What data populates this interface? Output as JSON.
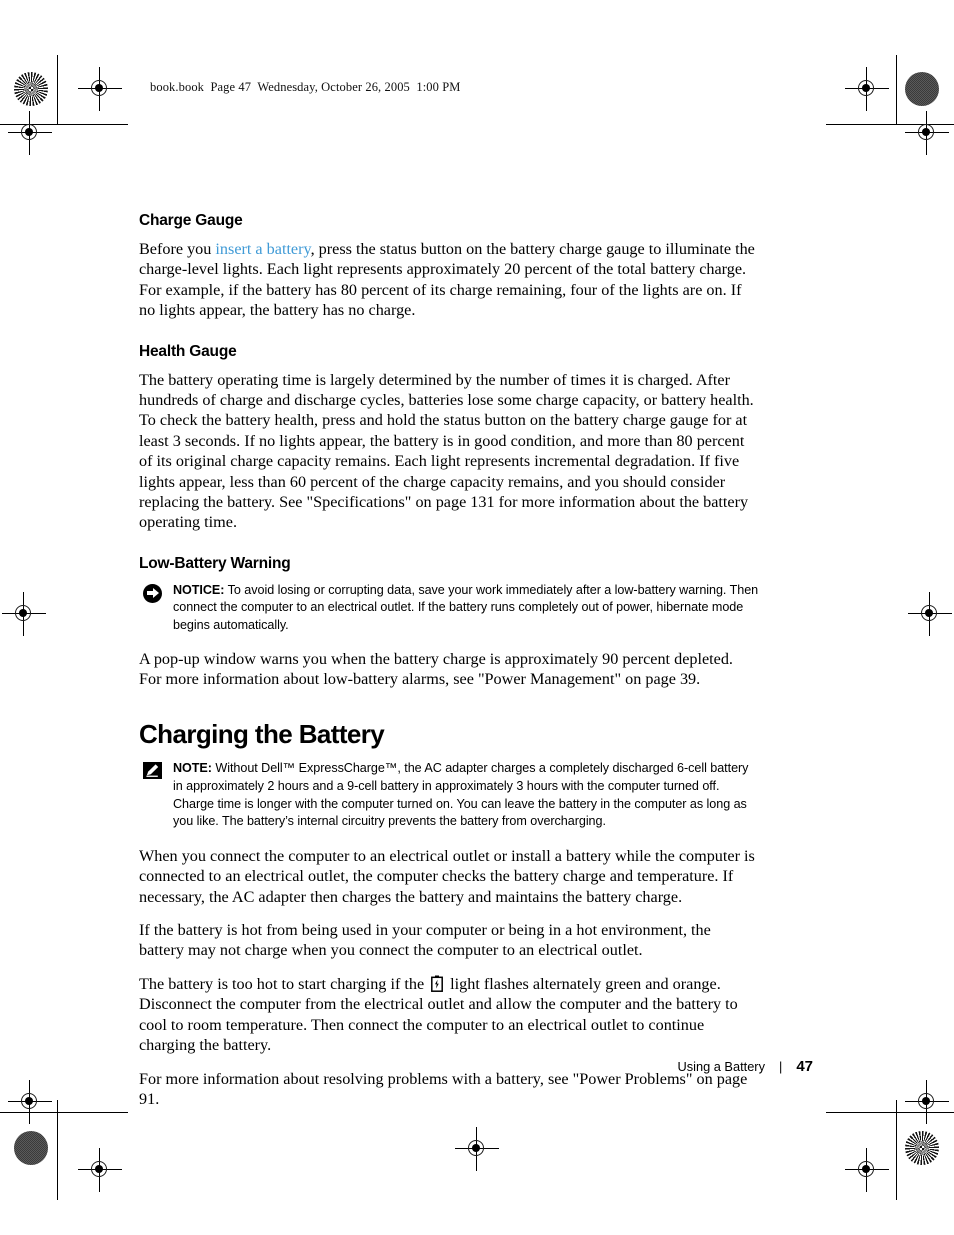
{
  "page": {
    "slug": "book.book  Page 47  Wednesday, October 26, 2005  1:00 PM",
    "link_color": "#3f9ad6"
  },
  "sections": {
    "charge_gauge": {
      "heading": "Charge Gauge",
      "para_before_link": "Before you ",
      "link_text": "insert a battery",
      "para_after_link": ", press the status button on the battery charge gauge to illuminate the charge-level lights. Each light represents approximately 20 percent of the total battery charge. For example, if the battery has 80 percent of its charge remaining, four of the lights are on. If no lights appear, the battery has no charge."
    },
    "health_gauge": {
      "heading": "Health Gauge",
      "paragraph": "The battery operating time is largely determined by the number of times it is charged. After hundreds of charge and discharge cycles, batteries lose some charge capacity, or battery health. To check the battery health, press and hold the status button on the battery charge gauge for at least 3 seconds. If no lights appear, the battery is in good condition, and more than 80 percent of its original charge capacity remains. Each light represents incremental degradation. If five lights appear, less than 60 percent of the charge capacity remains, and you should consider replacing the battery. See \"Specifications\" on page 131 for more information about the battery operating time."
    },
    "low_battery_warning": {
      "heading": "Low-Battery Warning",
      "notice_label": "NOTICE:",
      "notice_text": " To avoid losing or corrupting data, save your work immediately after a low-battery warning. Then connect the computer to an electrical outlet. If the battery runs completely out of power, hibernate mode begins automatically.",
      "paragraph": "A pop-up window warns you when the battery charge is approximately 90 percent depleted. For more information about low-battery alarms, see \"Power Management\" on page 39."
    },
    "charging_the_battery": {
      "heading": "Charging the Battery",
      "note_label": "NOTE:",
      "note_text": " Without Dell™ ExpressCharge™, the AC adapter charges a completely discharged 6-cell battery in approximately 2 hours and a 9-cell battery in approximately 3 hours with the computer turned off. Charge time is longer with the computer turned on. You can leave the battery in the computer as long as you like. The battery’s internal circuitry prevents the battery from overcharging.",
      "para1": "When you connect the computer to an electrical outlet or install a battery while the computer is connected to an electrical outlet, the computer checks the battery charge and temperature. If necessary, the AC adapter then charges the battery and maintains the battery charge.",
      "para2": "If the battery is hot from being used in your computer or being in a hot environment, the battery may not charge when you connect the computer to an electrical outlet.",
      "para3_before_icon": "The battery is too hot to start charging if the",
      "para3_after_icon": "light flashes alternately green and orange. Disconnect the computer from the electrical outlet and allow the computer and the battery to cool to room temperature. Then connect the computer to an electrical outlet to continue charging the battery.",
      "para4": "For more information about resolving problems with a battery, see \"Power Problems\" on page 91."
    }
  },
  "footer": {
    "section_name": "Using a Battery",
    "separator": "|",
    "page_number": "47"
  }
}
